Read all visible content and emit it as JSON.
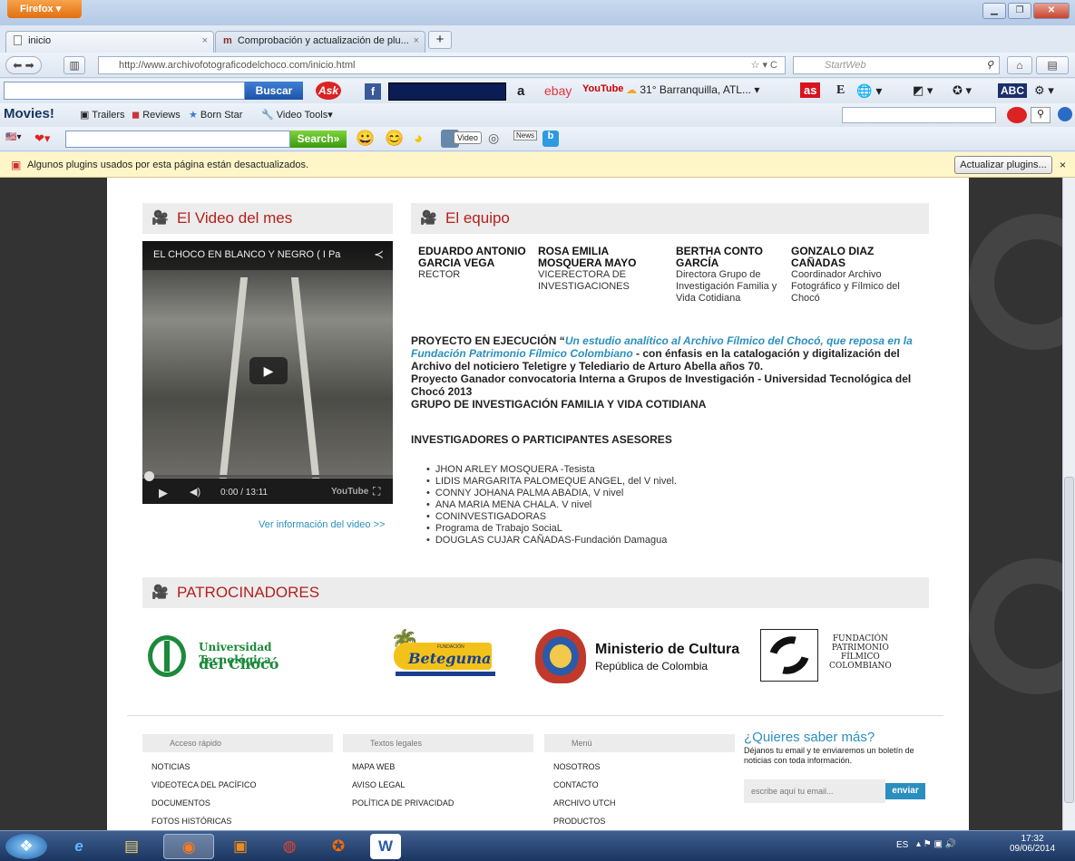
{
  "browser": {
    "menu_button": "Firefox ▾",
    "tabs": [
      {
        "label": "inicio"
      },
      {
        "label": "Comprobación y actualización de plu..."
      }
    ],
    "url": "http://www.archivofotograficodelchoco.com/inicio.html",
    "search_placeholder": "StartWeb"
  },
  "toolbars": {
    "buscar_label": "Buscar",
    "ask_label": "Ask",
    "ebay": "ebay",
    "youtube": "YouTube",
    "weather": "31° Barranquilla, ATL...",
    "as_label": "as",
    "movies_label": "Movies!",
    "trailers": "Trailers",
    "reviews": "Reviews",
    "born_star": "Born Star",
    "video_tools": "Video Tools",
    "search_label": "Search»",
    "video_label": "Video",
    "news_label": "News"
  },
  "plugin_notice": {
    "message": "Algunos plugins usados por esta página están desactualizados.",
    "button": "Actualizar plugins..."
  },
  "video_section": {
    "heading": "El Video del mes",
    "title": "EL CHOCO EN BLANCO Y NEGRO ( I  Pa",
    "time": "0:00 / 13:11",
    "more_link": "Ver información del video >>"
  },
  "team_section": {
    "heading": "El equipo",
    "members": [
      {
        "name": "EDUARDO ANTONIO GARCIA VEGA",
        "role": "RECTOR"
      },
      {
        "name": "ROSA EMILIA MOSQUERA MAYO",
        "role": "VICERECTORA DE INVESTIGACIONES"
      },
      {
        "name": "BERTHA CONTO GARCÍA",
        "role": "Directora Grupo de Investigación Familia y Vida Cotidiana"
      },
      {
        "name": "GONZALO DIAZ CAÑADAS",
        "role": "Coordinador Archivo Fotográfico y Fílmico del Chocó"
      }
    ],
    "project_prefix": "PROYECTO  EN EJECUCIÓN “",
    "project_title": "Un estudio  analítico  al Archivo Fílmico del Chocó, que reposa en la Fundación Patrimonio Fílmico Colombiano",
    "project_rest": " - con énfasis en la catalogación y digitalización del Archivo del noticiero Teletigre y Telediario de Arturo Abella años 70.",
    "project_line2": "Proyecto Ganador convocatoria Interna a Grupos de Investigación - Universidad Tecnológica del Chocó 2013",
    "project_line3": "GRUPO DE INVESTIGACIÓN FAMILIA Y VIDA COTIDIANA",
    "investigators_heading": "INVESTIGADORES O PARTICIPANTES ASESORES",
    "investigators": [
      "JHON ARLEY MOSQUERA -Tesista",
      "LIDIS MARGARITA PALOMEQUE ANGEL, del V nivel.",
      "CONNY JOHANA PALMA ABADIA, V nivel",
      "ANA MARIA MENA CHALA. V nivel",
      "CONINVESTIGADORAS",
      "Programa de Trabajo SociaL",
      "DOUGLAS CUJAR CAÑADAS-Fundación Damagua"
    ]
  },
  "sponsors": {
    "heading": "PATROCINADORES",
    "utch": [
      "Universidad Tecnológica",
      "del Chocó"
    ],
    "beteguma_small": "FUNDACIÓN",
    "beteguma": "Beteguma",
    "ministerio": [
      "Ministerio de Cultura",
      "República de Colombia"
    ],
    "fpfc": [
      "FUNDACIÓN",
      "PATRIMONIO",
      "FÍLMICO",
      "COLOMBIANO"
    ]
  },
  "footer": {
    "columns": [
      {
        "heading": "Acceso rápido",
        "links": [
          "NOTICIAS",
          "VIDEOTECA DEL PACÍFICO",
          "DOCUMENTOS",
          "FOTOS HISTÓRICAS"
        ]
      },
      {
        "heading": "Textos legales",
        "links": [
          "MAPA WEB",
          "AVISO LEGAL",
          "POLÍTICA DE PRIVACIDAD"
        ]
      },
      {
        "heading": "Menú",
        "links": [
          "NOSOTROS",
          "CONTACTO",
          "ARCHIVO UTCH",
          "PRODUCTOS"
        ]
      }
    ],
    "newsletter_heading": "¿Quieres saber más?",
    "newsletter_text": "Déjanos tu email y te enviaremos un boletín de noticias con toda información.",
    "email_placeholder": "escribe aquí tu email...",
    "send_button": "enviar"
  },
  "taskbar": {
    "lang": "ES",
    "time": "17:32",
    "date": "09/06/2014"
  }
}
